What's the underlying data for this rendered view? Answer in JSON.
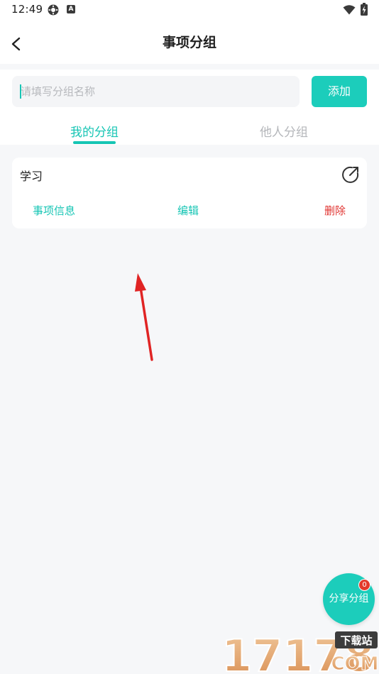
{
  "status_bar": {
    "time": "12:49",
    "a_badge": "A",
    "icons": [
      "gear-icon",
      "a-badge-icon",
      "wifi-icon",
      "battery-charging-icon"
    ]
  },
  "header": {
    "title": "事项分组",
    "back_icon": "chevron-left-icon"
  },
  "input": {
    "placeholder": "请填写分组名称",
    "value": ""
  },
  "add_button": {
    "label": "添加"
  },
  "tabs": [
    {
      "label": "我的分组",
      "active": true
    },
    {
      "label": "他人分组",
      "active": false
    }
  ],
  "groups": [
    {
      "name": "学习",
      "share_icon": "share-external-icon",
      "actions": {
        "info": "事项信息",
        "edit": "编辑",
        "delete": "删除"
      }
    }
  ],
  "fab": {
    "label": "分享分组",
    "badge": "0"
  },
  "colors": {
    "accent": "#1ccdbb",
    "accent_text": "#16c5b4",
    "danger": "#e0322f",
    "badge": "#e33a2a",
    "background": "#f6f7f9",
    "annotation_arrow": "#e02424"
  },
  "watermark": {
    "number": "17178",
    "tag": "下载站",
    "domain": "COM"
  }
}
